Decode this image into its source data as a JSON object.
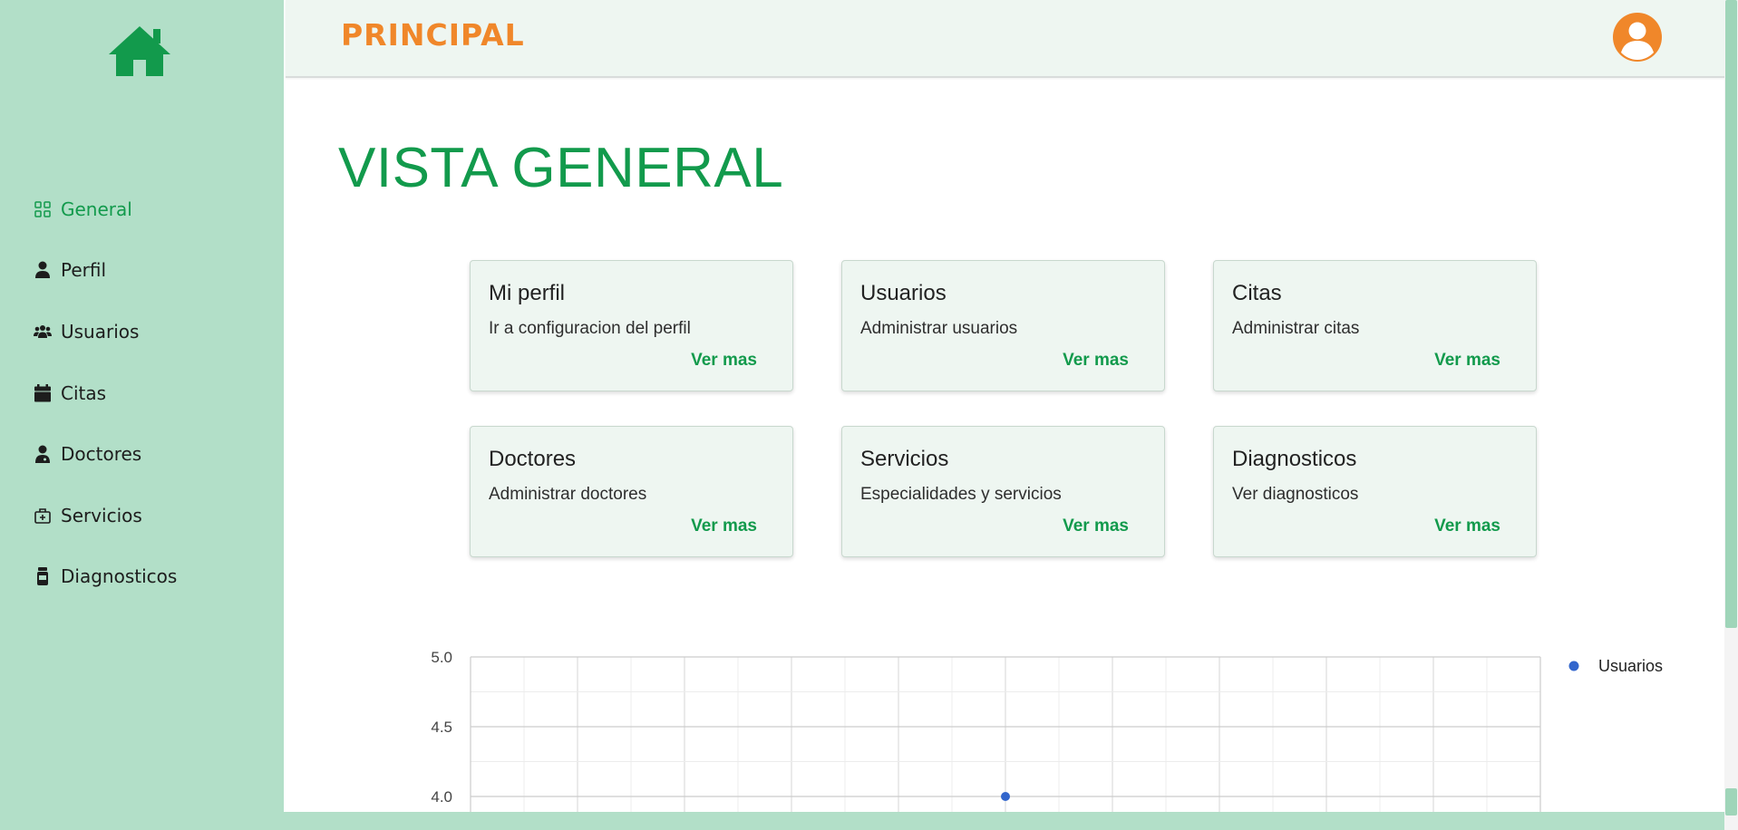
{
  "brand": {
    "title": "PRINCIPAL"
  },
  "colors": {
    "sidebar_bg": "#b2dfc8",
    "accent_green": "#129a4c",
    "brand_orange": "#f0872a",
    "card_bg": "#eef6f1",
    "series_blue": "#3366cc"
  },
  "sidebar": {
    "home_icon": "home-icon",
    "items": [
      {
        "label": "General",
        "icon": "grid-icon",
        "active": true
      },
      {
        "label": "Perfil",
        "icon": "person-icon",
        "active": false
      },
      {
        "label": "Usuarios",
        "icon": "users-icon",
        "active": false
      },
      {
        "label": "Citas",
        "icon": "calendar-icon",
        "active": false
      },
      {
        "label": "Doctores",
        "icon": "doctor-icon",
        "active": false
      },
      {
        "label": "Servicios",
        "icon": "medkit-icon",
        "active": false
      },
      {
        "label": "Diagnosticos",
        "icon": "pill-bottle-icon",
        "active": false
      }
    ]
  },
  "header": {
    "user_icon": "user-avatar-icon"
  },
  "main": {
    "title": "VISTA GENERAL",
    "cards": [
      {
        "title": "Mi perfil",
        "description": "Ir a configuracion del perfil",
        "link": "Ver mas"
      },
      {
        "title": "Usuarios",
        "description": "Administrar usuarios",
        "link": "Ver mas"
      },
      {
        "title": "Citas",
        "description": "Administrar citas",
        "link": "Ver mas"
      },
      {
        "title": "Doctores",
        "description": "Administrar doctores",
        "link": "Ver mas"
      },
      {
        "title": "Servicios",
        "description": "Especialidades y servicios",
        "link": "Ver mas"
      },
      {
        "title": "Diagnosticos",
        "description": "Ver diagnosticos",
        "link": "Ver mas"
      }
    ]
  },
  "chart_data": {
    "type": "scatter",
    "title": "",
    "xlabel": "",
    "ylabel": "",
    "yticks": [
      "5.0",
      "4.5",
      "4.0"
    ],
    "ylim_visible": [
      4.0,
      5.0
    ],
    "grid": true,
    "legend_position": "right",
    "series": [
      {
        "name": "Usuarios",
        "color": "#3366cc",
        "points": [
          {
            "y": 4.0
          }
        ]
      }
    ]
  }
}
